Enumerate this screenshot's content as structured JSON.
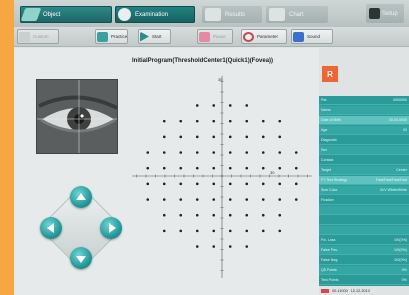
{
  "tabs": {
    "object": "Object",
    "examination": "Examination",
    "results": "Results",
    "chart": "Chart",
    "setup": "Setup"
  },
  "toolbar": {
    "custom": "Custom",
    "practice": "Practice",
    "start": "Start",
    "pause": "Pause",
    "parameter": "Parameter",
    "sound": "Sound"
  },
  "program_title": "InitialProgram(ThresholdCenter1(Quick1)(Fovea))",
  "axis": {
    "top_label": "30",
    "right_label": "30"
  },
  "eye": "R",
  "info_rows": [
    {
      "label": "Pat.",
      "value": "0000000"
    },
    {
      "label": "Name",
      "value": ""
    },
    {
      "label": "Date of Birth",
      "value": "00.00.0000"
    },
    {
      "label": "Age",
      "value": "00"
    },
    {
      "label": "Diagnosis",
      "value": ""
    },
    {
      "label": "Sex",
      "value": ""
    },
    {
      "label": "Contact",
      "value": ""
    },
    {
      "label": "Target",
      "value": "Center"
    },
    {
      "label": "FT Test Strategy",
      "value": "Fast/Fast/Fast/Fast"
    },
    {
      "label": "Size Color",
      "value": "III/V White/White"
    },
    {
      "label": "Fixation",
      "value": ""
    },
    {
      "label": "",
      "value": ""
    },
    {
      "label": "",
      "value": ""
    },
    {
      "label": "",
      "value": ""
    },
    {
      "label": "Fix. Loss",
      "value": "0/0(0%)"
    },
    {
      "label": "False Pos.",
      "value": "0/0(0%)"
    },
    {
      "label": "False Neg.",
      "value": "0/0(0%)"
    },
    {
      "label": "Q5 Points",
      "value": "0%"
    },
    {
      "label": "Test Points",
      "value": "0%"
    }
  ],
  "footer": {
    "id": "00-11000",
    "date": "12.12.2013"
  },
  "colors": {
    "accent": "#2b9b99",
    "tab_active": "#1d6464",
    "eye_badge": "#ef6632",
    "page_border": "#f5a742"
  }
}
